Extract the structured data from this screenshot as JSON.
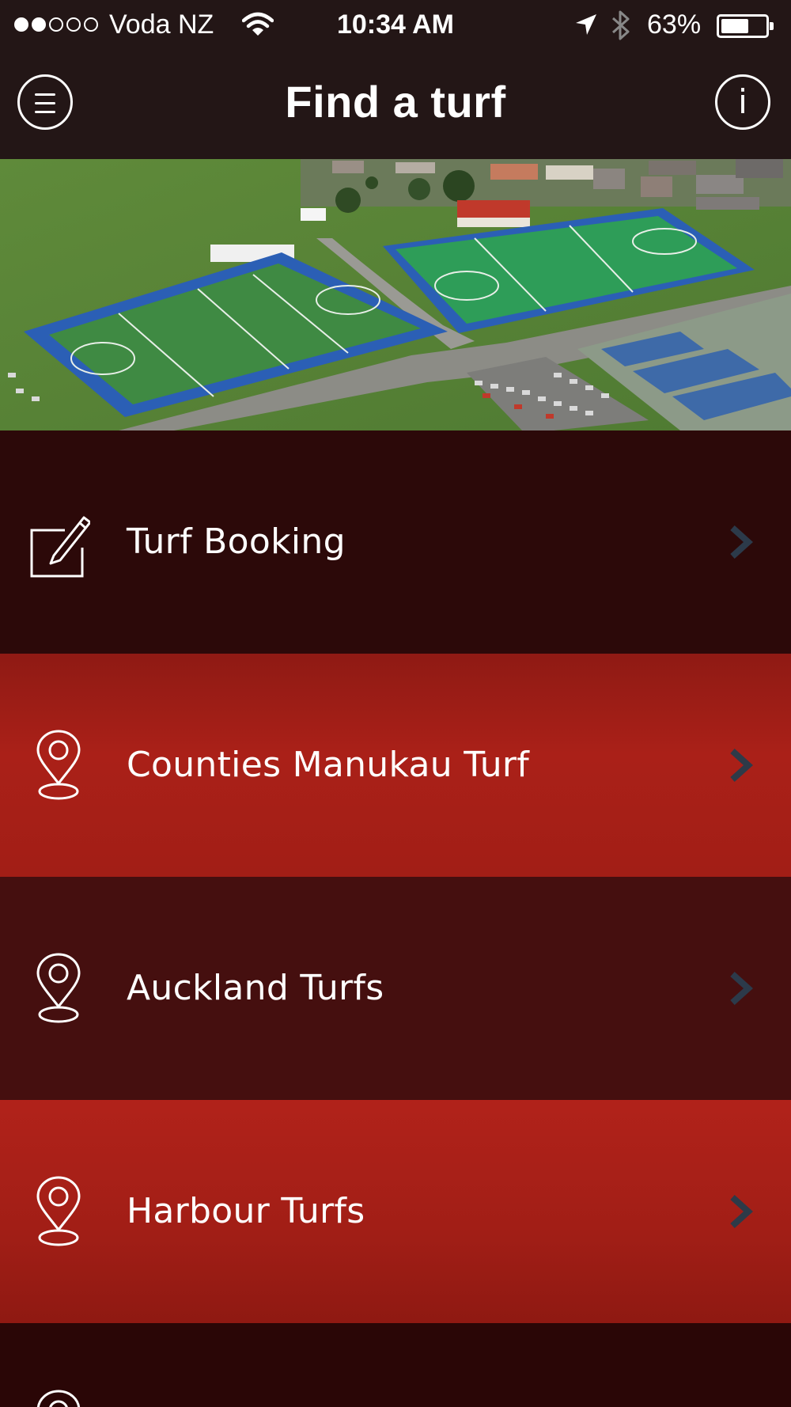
{
  "status_bar": {
    "carrier": "Voda NZ",
    "time": "10:34 AM",
    "battery_percent": "63%",
    "battery_level": 0.63,
    "signal_bars_filled": 2,
    "signal_bars_total": 5
  },
  "header": {
    "title": "Find a turf",
    "menu_icon": "hamburger-menu-icon",
    "info_label": "i"
  },
  "hero": {
    "icon": "aerial-turf-photo"
  },
  "menu": {
    "items": [
      {
        "label": "Turf Booking",
        "icon": "edit-icon"
      },
      {
        "label": "Counties Manukau Turf",
        "icon": "map-pin-icon"
      },
      {
        "label": "Auckland Turfs",
        "icon": "map-pin-icon"
      },
      {
        "label": "Harbour Turfs",
        "icon": "map-pin-icon"
      }
    ]
  },
  "colors": {
    "nav_background": "#231616",
    "dark_row": "#2c0909",
    "red_row": "#aa2018",
    "chevron_dark": "#2c3a4a",
    "chevron_light": "#2e3a48"
  }
}
